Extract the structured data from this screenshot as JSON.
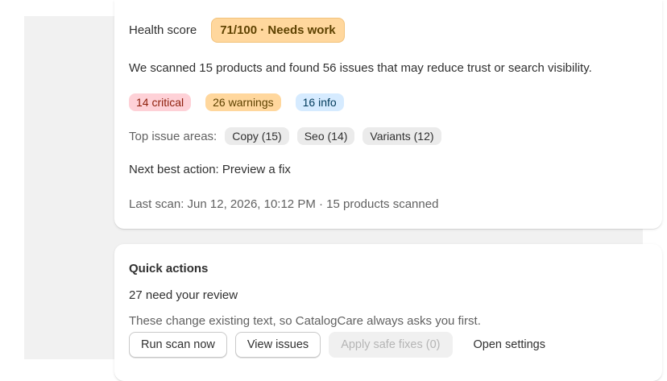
{
  "summary": {
    "health_label": "Health score",
    "health_badge": "71/100 · Needs work",
    "scan_text": "We scanned 15 products and found 56 issues that may reduce trust or search visibility.",
    "badges": {
      "critical": "14 critical",
      "warnings": "26 warnings",
      "info": "16 info"
    },
    "top_areas_label": "Top issue areas:",
    "top_areas": [
      "Copy (15)",
      "Seo (14)",
      "Variants (12)"
    ],
    "next_action": "Next best action: Preview a fix",
    "last_scan": "Last scan: Jun 12, 2026, 10:12 PM · 15 products scanned"
  },
  "quick_actions": {
    "title": "Quick actions",
    "review_count": "27 need your review",
    "note": "These change existing text, so CatalogCare always asks you first.",
    "buttons": {
      "run_scan": "Run scan now",
      "view_issues": "View issues",
      "apply_fixes": "Apply safe fixes (0)",
      "open_settings": "Open settings"
    }
  },
  "colors": {
    "warning_bg": "#ffd79d",
    "critical_bg": "#fed1d7",
    "info_bg": "#d6ebff",
    "tag_bg": "#ebebeb",
    "page_bg": "#f1f1f1"
  }
}
